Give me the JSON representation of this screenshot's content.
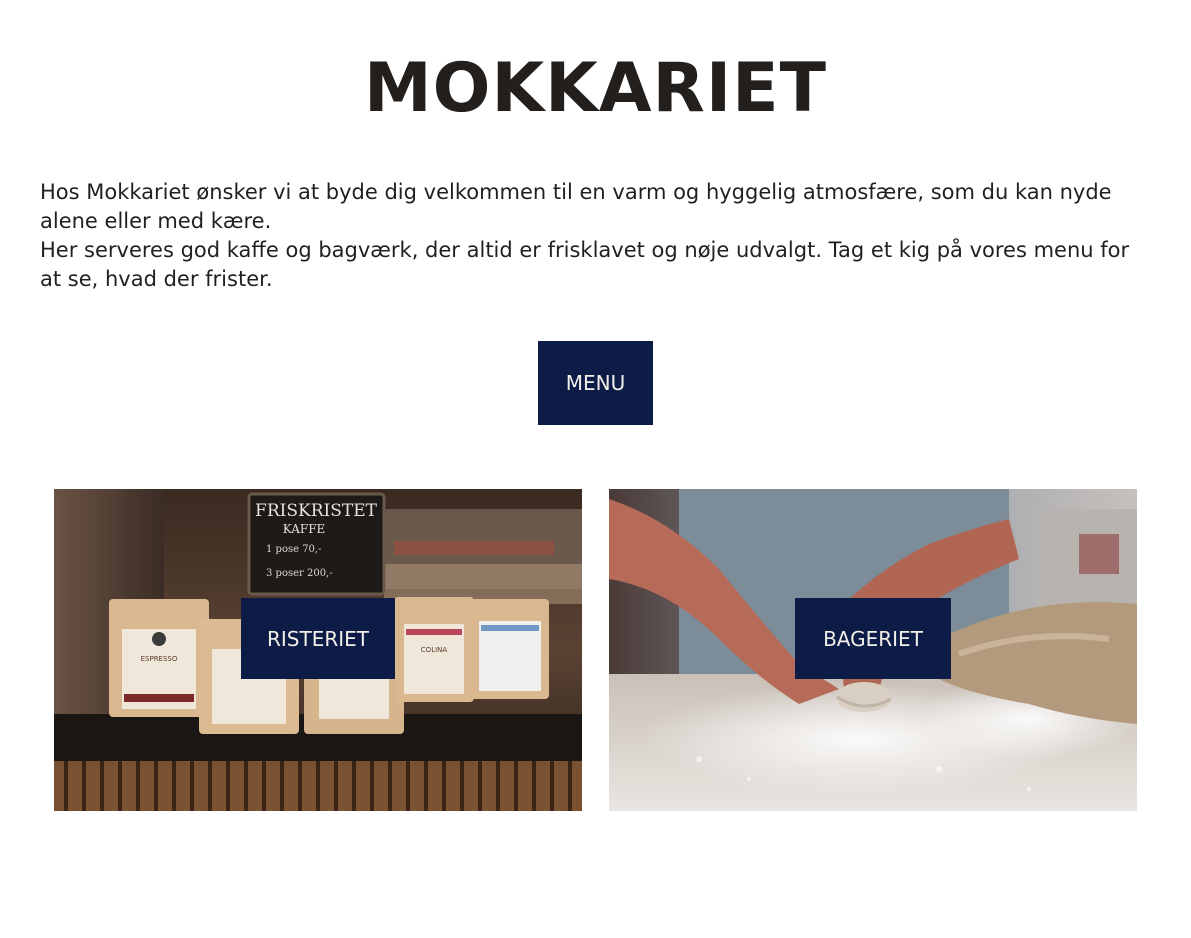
{
  "header": {
    "title": "MOKKARIET"
  },
  "intro": {
    "paragraph_1": "Hos Mokkariet ønsker vi at byde dig velkommen til en varm og hyggelig atmosfære, som du kan nyde alene eller med kære.",
    "paragraph_2": "Her serveres god kaffe og bagværk, der altid er frisklavet og nøje udvalgt. Tag et kig på vores menu for at se, hvad der frister."
  },
  "menu_button": {
    "label": "MENU"
  },
  "cards": [
    {
      "label": "RISTERIET",
      "photo": {
        "chalkboard_line_1": "FRISKRISTET",
        "chalkboard_line_2": "KAFFE",
        "chalkboard_price_1": "1 pose   70,-",
        "chalkboard_price_2": "3 poser  200,-",
        "bag_label_1": "ESPRESSO",
        "bag_label_2": "COLINA"
      }
    },
    {
      "label": "BAGERIET"
    }
  ],
  "colors": {
    "button_background": "#0d1c47",
    "button_text": "#f2efe8",
    "title_text": "#231f1c"
  }
}
